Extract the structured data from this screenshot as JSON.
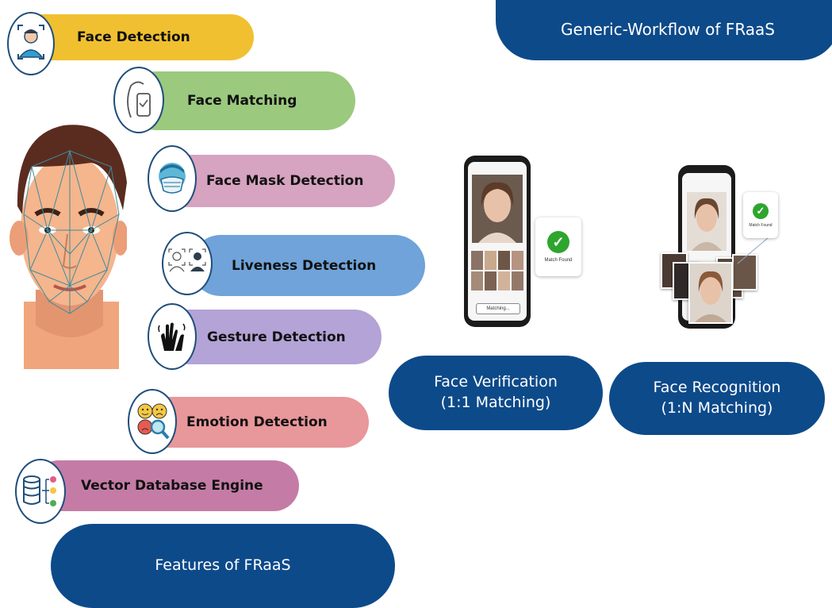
{
  "workflow_title": "Generic-Workflow of FRaaS",
  "features_title": "Features of FRaaS",
  "features": [
    {
      "label": "Face Detection",
      "color": "#f0c030",
      "icon": "person-scan-icon"
    },
    {
      "label": "Face Matching",
      "color": "#9bc97e",
      "icon": "face-phone-icon"
    },
    {
      "label": "Face Mask Detection",
      "color": "#d6a3c0",
      "icon": "mask-icon"
    },
    {
      "label": "Liveness Detection",
      "color": "#6fa3d9",
      "icon": "liveness-icon"
    },
    {
      "label": "Gesture Detection",
      "color": "#b3a3d6",
      "icon": "gesture-hands-icon"
    },
    {
      "label": "Emotion Detection",
      "color": "#e8979a",
      "icon": "emotion-faces-icon"
    },
    {
      "label": "Vector Database Engine",
      "color": "#c47ca6",
      "icon": "database-icon"
    }
  ],
  "verification": {
    "title": "Face Verification",
    "subtitle": "(1:1 Matching)",
    "status": "Match Found",
    "progress": "Matching..."
  },
  "recognition": {
    "title": "Face Recognition",
    "subtitle": "(1:N Matching)",
    "status": "Match Found"
  },
  "colors": {
    "primary": "#0d4a8a"
  }
}
